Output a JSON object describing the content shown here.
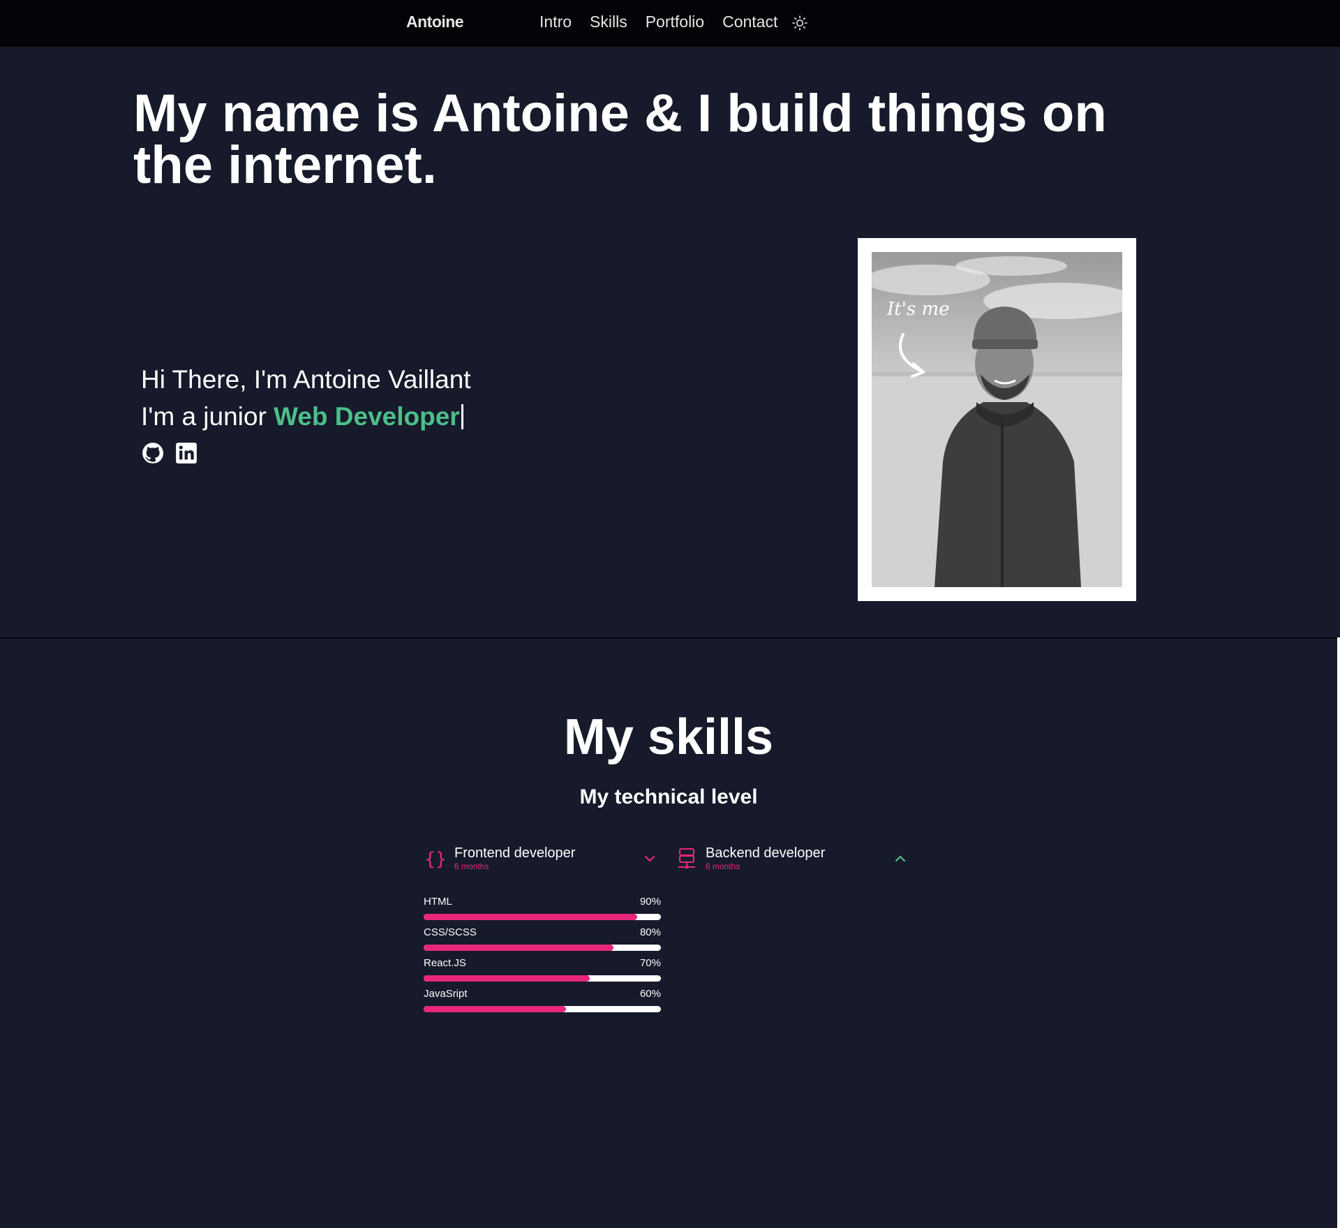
{
  "nav": {
    "brand": "Antoine",
    "links": [
      "Intro",
      "Skills",
      "Portfolio",
      "Contact"
    ],
    "theme_icon": "sun-icon"
  },
  "hero": {
    "title": "My name is Antoine & I build things on the internet.",
    "greeting": "Hi There, I'm Antoine Vaillant",
    "role_prefix": "I'm a junior ",
    "role_highlight": "Web Developer",
    "accent_color": "#4cbf8a",
    "social_icons": [
      "github-icon",
      "linkedin-icon"
    ],
    "photo_caption": "It's me"
  },
  "skills": {
    "title": "My skills",
    "subtitle": "My technical level",
    "accent_color": "#e9277a",
    "categories": [
      {
        "title": "Frontend developer",
        "duration": "6 months",
        "icon": "code-braces-icon",
        "chevron": "chevron-down-icon"
      },
      {
        "title": "Backend developer",
        "duration": "6 months",
        "icon": "server-icon",
        "chevron": "chevron-up-icon"
      }
    ],
    "items": [
      {
        "name": "HTML",
        "percent_label": "90%",
        "level": 0.9
      },
      {
        "name": "CSS/SCSS",
        "percent_label": "80%",
        "level": 0.8
      },
      {
        "name": "React.JS",
        "percent_label": "70%",
        "level": 0.7
      },
      {
        "name": "JavaSript",
        "percent_label": "60%",
        "level": 0.6
      }
    ]
  }
}
